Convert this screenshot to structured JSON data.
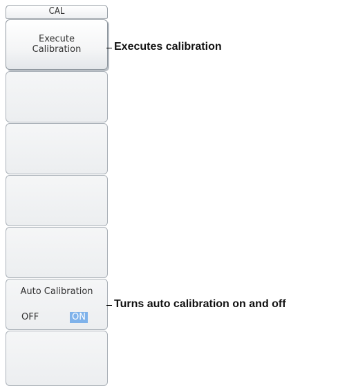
{
  "menu": {
    "title": "CAL",
    "keys": [
      {
        "line1": "Execute",
        "line2": "Calibration"
      },
      {},
      {},
      {},
      {},
      {
        "label": "Auto  Calibration",
        "options": {
          "off": "OFF",
          "on": "ON",
          "selected": "ON"
        }
      },
      {}
    ]
  },
  "callouts": {
    "execute": "Executes calibration",
    "auto": "Turns auto calibration on and off"
  },
  "colors": {
    "selected_option_bg": "#7fb2ea",
    "key_border": "#aab1b8"
  }
}
